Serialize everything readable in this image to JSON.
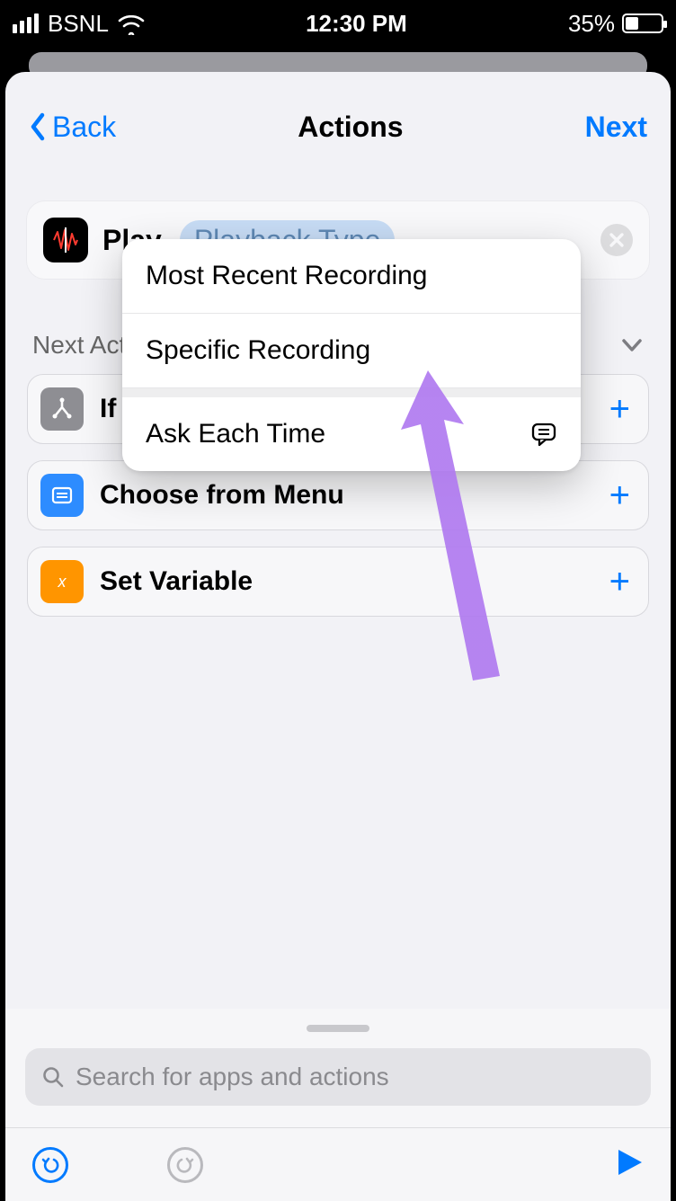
{
  "status_bar": {
    "carrier": "BSNL",
    "time": "12:30 PM",
    "battery_pct": "35%"
  },
  "nav": {
    "back": "Back",
    "title": "Actions",
    "next": "Next"
  },
  "action": {
    "play_label": "Play",
    "playback_type": "Playback Type"
  },
  "section": {
    "next_label": "Next Action Suggestions"
  },
  "popup": {
    "opt1": "Most Recent Recording",
    "opt2": "Specific Recording",
    "opt3": "Ask Each Time"
  },
  "suggestions": {
    "row1": "If",
    "row2": "Choose from Menu",
    "row3": "Set Variable"
  },
  "search": {
    "placeholder": "Search for apps and actions"
  }
}
